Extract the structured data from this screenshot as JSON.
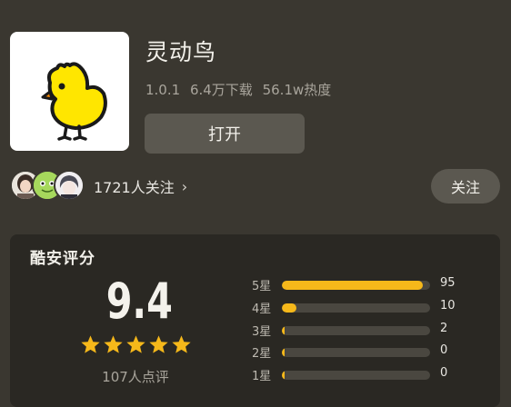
{
  "app": {
    "name": "灵动鸟",
    "version": "1.0.1",
    "downloads": "6.4万下载",
    "heat": "56.1w热度",
    "open_label": "打开",
    "icon": "yellow-chick-icon"
  },
  "social": {
    "followers_text": "1721人关注",
    "chevron": "›",
    "follow_label": "关注"
  },
  "rating": {
    "title": "酷安评分",
    "score": "9.4",
    "stars": 5,
    "review_count": "107人点评",
    "distribution": [
      {
        "label": "5星",
        "count": "95",
        "fraction": 0.95
      },
      {
        "label": "4星",
        "count": "10",
        "fraction": 0.1
      },
      {
        "label": "3星",
        "count": "2",
        "fraction": 0.02
      },
      {
        "label": "2星",
        "count": "0",
        "fraction": 0.0
      },
      {
        "label": "1星",
        "count": "0",
        "fraction": 0.0
      }
    ]
  },
  "colors": {
    "background": "#3a3730",
    "card": "#2a2823",
    "accent": "#f6b81a",
    "button": "#5b5850"
  }
}
